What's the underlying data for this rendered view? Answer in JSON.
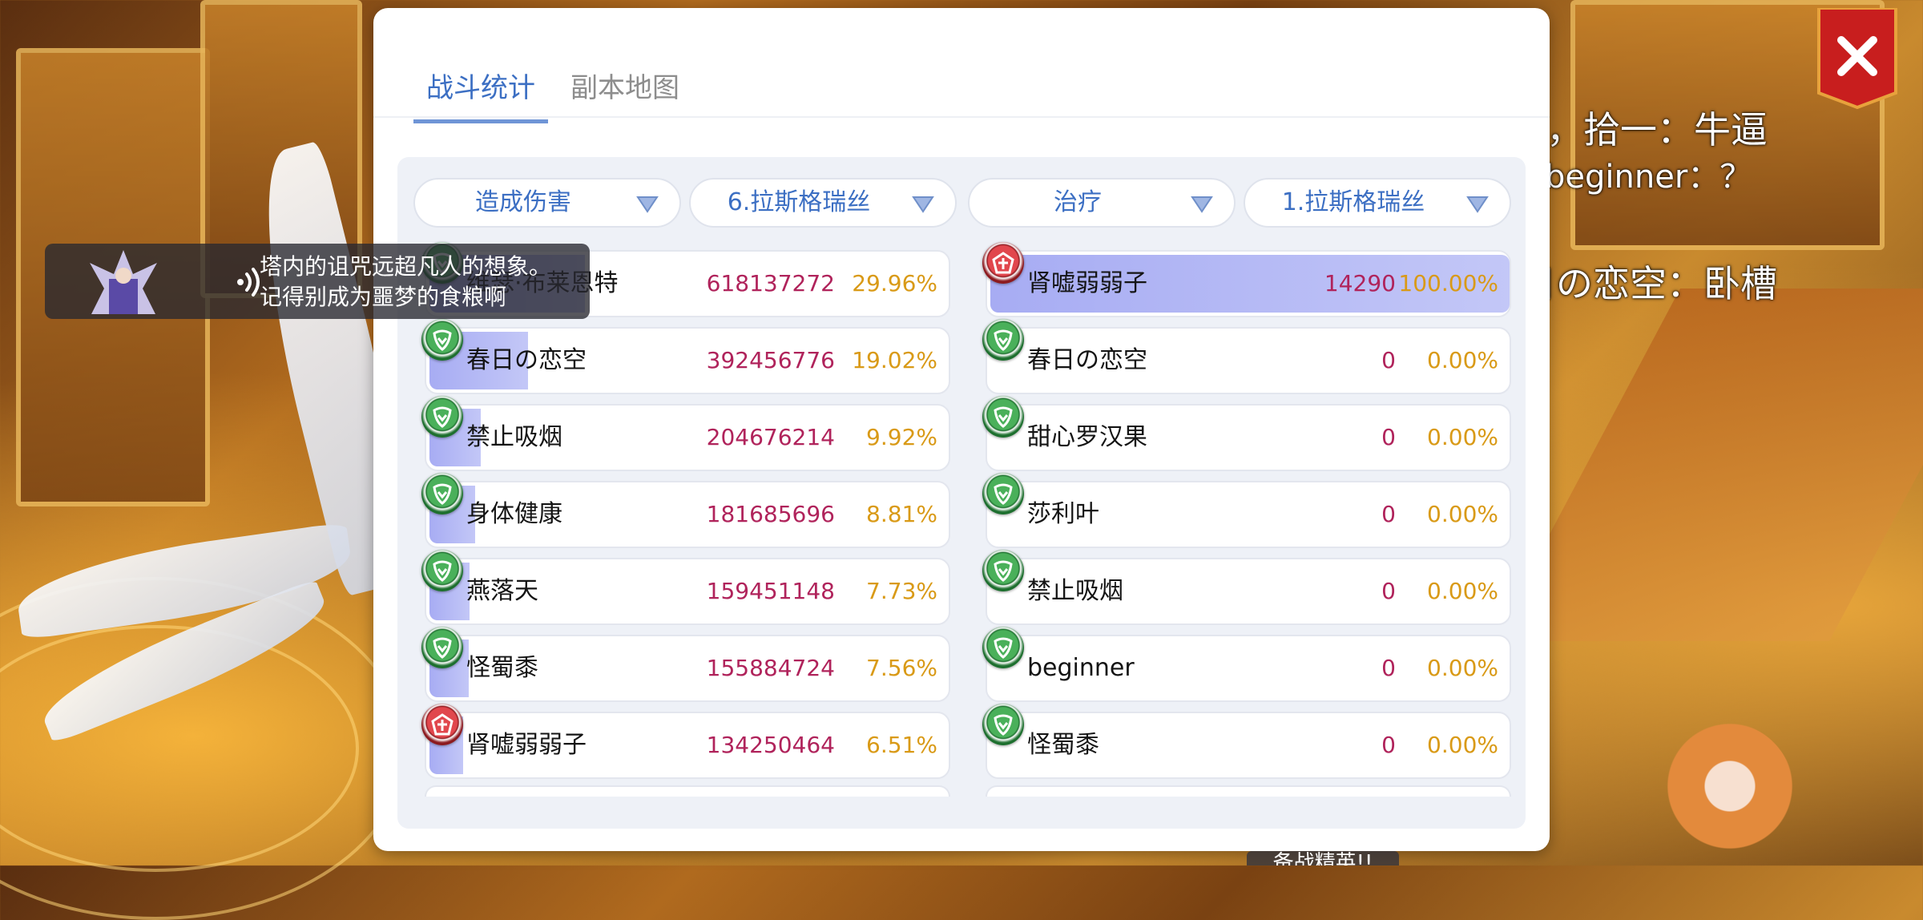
{
  "chat_lines": [
    {
      "text": "，拾一：牛逼"
    },
    {
      "text": "beginner：？"
    },
    {
      "text": "春日の恋空：卧槽"
    }
  ],
  "notification": {
    "line1": "塔内的诅咒远超凡人的想象。",
    "line2": "记得别成为噩梦的食粮啊"
  },
  "panel": {
    "tabs": [
      {
        "label": "战斗统计",
        "active": true
      },
      {
        "label": "副本地图",
        "active": false
      }
    ],
    "close_icon": "close-x-icon",
    "left": {
      "filter_type": "造成伤害",
      "filter_target": "6.拉斯格瑞丝",
      "rows": [
        {
          "name": "维瑟·布莱恩特",
          "value": "618137272",
          "percent": "29.96%",
          "share": 0.2996,
          "badge": "green"
        },
        {
          "name": "春日の恋空",
          "value": "392456776",
          "percent": "19.02%",
          "share": 0.1902,
          "badge": "green"
        },
        {
          "name": "禁止吸烟",
          "value": "204676214",
          "percent": "9.92%",
          "share": 0.0992,
          "badge": "green"
        },
        {
          "name": "身体健康",
          "value": "181685696",
          "percent": "8.81%",
          "share": 0.0881,
          "badge": "green"
        },
        {
          "name": "燕落天",
          "value": "159451148",
          "percent": "7.73%",
          "share": 0.0773,
          "badge": "green"
        },
        {
          "name": "怪蜀黍",
          "value": "155884724",
          "percent": "7.56%",
          "share": 0.0756,
          "badge": "green"
        },
        {
          "name": "肾嘘弱弱子",
          "value": "134250464",
          "percent": "6.51%",
          "share": 0.0651,
          "badge": "red"
        }
      ]
    },
    "right": {
      "filter_type": "治疗",
      "filter_target": "1.拉斯格瑞丝",
      "rows": [
        {
          "name": "肾嘘弱弱子",
          "value": "14290",
          "percent": "100.00%",
          "share": 1.0,
          "badge": "red"
        },
        {
          "name": "春日の恋空",
          "value": "0",
          "percent": "0.00%",
          "share": 0,
          "badge": "green"
        },
        {
          "name": "甜心罗汉果",
          "value": "0",
          "percent": "0.00%",
          "share": 0,
          "badge": "green"
        },
        {
          "name": "莎利叶",
          "value": "0",
          "percent": "0.00%",
          "share": 0,
          "badge": "green"
        },
        {
          "name": "禁止吸烟",
          "value": "0",
          "percent": "0.00%",
          "share": 0,
          "badge": "green"
        },
        {
          "name": "beginner",
          "value": "0",
          "percent": "0.00%",
          "share": 0,
          "badge": "green"
        },
        {
          "name": "怪蜀黍",
          "value": "0",
          "percent": "0.00%",
          "share": 0,
          "badge": "green"
        }
      ]
    }
  },
  "bottom_label": "备战精英!!"
}
